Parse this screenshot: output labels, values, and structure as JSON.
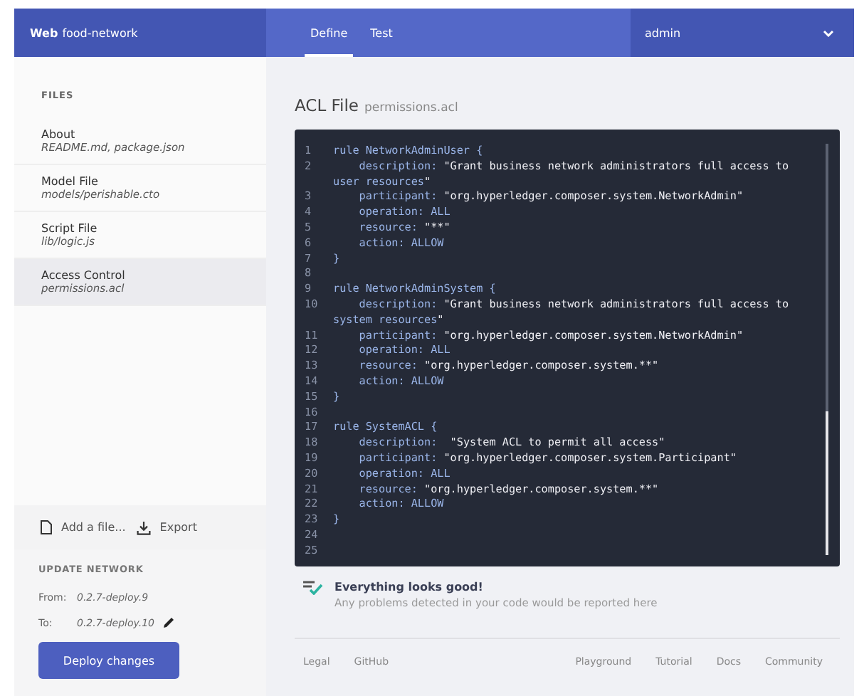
{
  "header": {
    "brand_bold": "Web",
    "brand": "food-network",
    "tabs": [
      {
        "label": "Define",
        "selected": true
      },
      {
        "label": "Test",
        "selected": false
      }
    ],
    "user": "admin"
  },
  "sidebar": {
    "heading": "FILES",
    "files": [
      {
        "title": "About",
        "subtitle": "README.md, package.json",
        "selected": false
      },
      {
        "title": "Model File",
        "subtitle": "models/perishable.cto",
        "selected": false
      },
      {
        "title": "Script File",
        "subtitle": "lib/logic.js",
        "selected": false
      },
      {
        "title": "Access Control",
        "subtitle": "permissions.acl",
        "selected": true
      }
    ],
    "add_file": "Add a file...",
    "export": "Export",
    "update": {
      "heading": "UPDATE NETWORK",
      "from_label": "From:",
      "from": "0.2.7-deploy.9",
      "to_label": "To:",
      "to": "0.2.7-deploy.10",
      "button": "Deploy changes"
    }
  },
  "editor": {
    "title": "ACL File",
    "filename": "permissions.acl",
    "lines": [
      {
        "number": "1",
        "text": "rule NetworkAdminUser {"
      },
      {
        "number": "2",
        "text": "    description: \"Grant business network administrators full access to",
        "continuation": "user resources\""
      },
      {
        "number": "3",
        "text": "    participant: \"org.hyperledger.composer.system.NetworkAdmin\""
      },
      {
        "number": "4",
        "text": "    operation: ALL"
      },
      {
        "number": "5",
        "text": "    resource: \"**\""
      },
      {
        "number": "6",
        "text": "    action: ALLOW"
      },
      {
        "number": "7",
        "text": "}"
      },
      {
        "number": "8"
      },
      {
        "number": "9",
        "text": "rule NetworkAdminSystem {"
      },
      {
        "number": "10",
        "text": "    description: \"Grant business network administrators full access to",
        "continuation": "system resources\""
      },
      {
        "number": "11",
        "text": "    participant: \"org.hyperledger.composer.system.NetworkAdmin\""
      },
      {
        "number": "12",
        "text": "    operation: ALL"
      },
      {
        "number": "13",
        "text": "    resource: \"org.hyperledger.composer.system.**\""
      },
      {
        "number": "14",
        "text": "    action: ALLOW"
      },
      {
        "number": "15",
        "text": "}"
      },
      {
        "number": "16"
      },
      {
        "number": "17",
        "text": "rule SystemACL {"
      },
      {
        "number": "18",
        "text": "    description:  \"System ACL to permit all access\""
      },
      {
        "number": "19",
        "text": "    participant: \"org.hyperledger.composer.system.Participant\""
      },
      {
        "number": "20",
        "text": "    operation: ALL"
      },
      {
        "number": "21",
        "text": "    resource: \"org.hyperledger.composer.system.**\""
      },
      {
        "number": "22",
        "text": "    action: ALLOW"
      },
      {
        "number": "23",
        "text": "}"
      },
      {
        "number": "24"
      },
      {
        "number": "25"
      }
    ]
  },
  "status": {
    "title": "Everything looks good!",
    "message": "Any problems detected in your code would be reported here"
  },
  "footer": {
    "left": [
      "Legal",
      "GitHub"
    ],
    "right": [
      "Playground",
      "Tutorial",
      "Docs",
      "Community"
    ]
  }
}
